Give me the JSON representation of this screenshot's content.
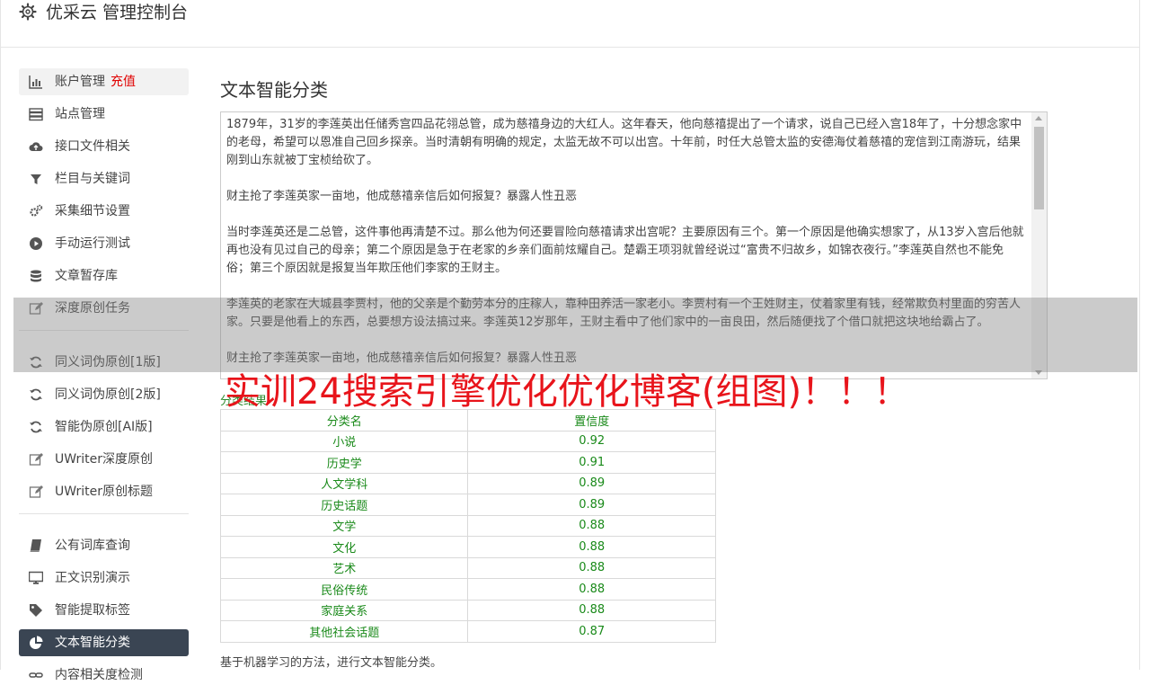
{
  "header": {
    "title": "优采云 管理控制台"
  },
  "sidebar": {
    "items": [
      {
        "label": "账户管理",
        "highlight": "充值",
        "icon": "bar-chart-icon"
      },
      {
        "label": "站点管理",
        "icon": "server-icon"
      },
      {
        "label": "接口文件相关",
        "icon": "cloud-upload-icon"
      },
      {
        "label": "栏目与关键词",
        "icon": "filter-icon"
      },
      {
        "label": "采集细节设置",
        "icon": "cogs-icon"
      },
      {
        "label": "手动运行测试",
        "icon": "play-circle-icon"
      },
      {
        "label": "文章暂存库",
        "icon": "database-icon"
      },
      {
        "label": "深度原创任务",
        "icon": "edit-icon"
      },
      {
        "label": "同义词伪原创[1版]",
        "icon": "refresh-icon"
      },
      {
        "label": "同义词伪原创[2版]",
        "icon": "refresh-icon"
      },
      {
        "label": "智能伪原创[AI版]",
        "icon": "refresh-icon"
      },
      {
        "label": "UWriter深度原创",
        "icon": "edit-icon"
      },
      {
        "label": "UWriter原创标题",
        "icon": "edit-icon"
      },
      {
        "label": "公有词库查询",
        "icon": "book-icon"
      },
      {
        "label": "正文识别演示",
        "icon": "desktop-icon"
      },
      {
        "label": "智能提取标签",
        "icon": "tag-icon"
      },
      {
        "label": "文本智能分类",
        "icon": "pie-chart-icon"
      },
      {
        "label": "内容相关度检测",
        "icon": "link-icon"
      }
    ]
  },
  "main": {
    "title": "文本智能分类",
    "text_paragraphs": [
      "1879年，31岁的李莲英出任储秀宫四品花翎总管，成为慈禧身边的大红人。这年春天，他向慈禧提出了一个请求，说自己已经入宫18年了，十分想念家中的老母，希望可以恩准自己回乡探亲。当时清朝有明确的规定，太监无故不可以出宫。十年前，时任大总管太监的安德海仗着慈禧的宠信到江南游玩，结果刚到山东就被丁宝桢给砍了。",
      "财主抢了李莲英家一亩地，他成慈禧亲信后如何报复？暴露人性丑恶",
      "当时李莲英还是二总管，这件事他再清楚不过。那么他为何还要冒险向慈禧请求出宫呢？主要原因有三个。第一个原因是他确实想家了，从13岁入宫后他就再也没有见过自己的母亲；第二个原因是急于在老家的乡亲们面前炫耀自己。楚霸王项羽就曾经说过“富贵不归故乡，如锦衣夜行。”李莲英自然也不能免俗；第三个原因就是报复当年欺压他们李家的王财主。",
      "李莲英的老家在大城县李贾村，他的父亲是个勤劳本分的庄稼人，靠种田养活一家老小。李贾村有一个王姓财主，仗着家里有钱，经常欺负村里面的穷苦人家。只要是他看上的东西，总要想方设法搞过来。李莲英12岁那年，王财主看中了他们家中的一亩良田，然后随便找了个借口就把这块地给霸占了。",
      "财主抢了李莲英家一亩地，他成慈禧亲信后如何报复？暴露人性丑恶"
    ],
    "result_label": "分类结果",
    "watermark": "实训24搜索引擎优化优化博客(组图)！！！",
    "table": {
      "headers": [
        "分类名",
        "置信度"
      ],
      "rows": [
        [
          "小说",
          "0.92"
        ],
        [
          "历史学",
          "0.91"
        ],
        [
          "人文学科",
          "0.89"
        ],
        [
          "历史话题",
          "0.89"
        ],
        [
          "文学",
          "0.88"
        ],
        [
          "文化",
          "0.88"
        ],
        [
          "艺术",
          "0.88"
        ],
        [
          "民俗传统",
          "0.88"
        ],
        [
          "家庭关系",
          "0.88"
        ],
        [
          "其他社会话题",
          "0.87"
        ]
      ]
    },
    "footnote": "基于机器学习的方法，进行文本智能分类。"
  },
  "colors": {
    "active_nav_bg": "#3a4553",
    "table_text": "#1a8a1a",
    "watermark": "#e8141b",
    "highlight": "#e00000"
  }
}
